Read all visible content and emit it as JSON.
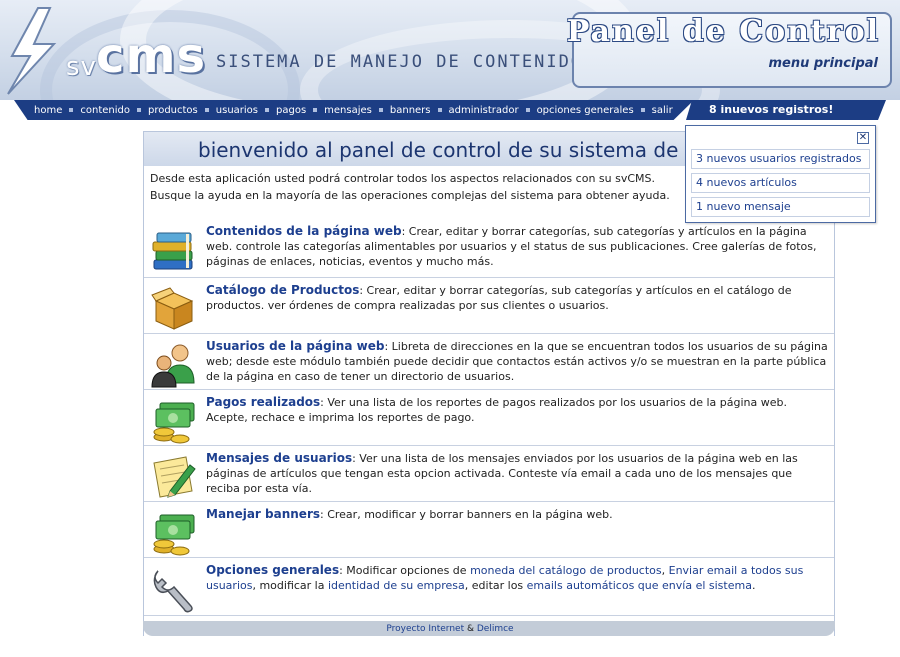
{
  "header": {
    "brand_prefix": "sv",
    "brand_name": "cms",
    "brand_subtitle": "SISTEMA DE MANEJO DE CONTENIDO WEB",
    "title": "Panel de Control",
    "subtitle": "menu principal"
  },
  "nav": {
    "items": [
      "home",
      "contenido",
      "productos",
      "usuarios",
      "pagos",
      "mensajes",
      "banners",
      "administrador",
      "opciones generales",
      "salir"
    ],
    "new_records": "8 inuevos registros!"
  },
  "panel": {
    "title": "bienvenido al panel de control de su sistema de contenido",
    "intro": "Desde esta aplicación usted podrá controlar todos los aspectos relacionados con su svCMS. Busque la ayuda en la mayoría de las operaciones complejas del sistema para obtener ayuda."
  },
  "sections": [
    {
      "icon": "books-icon",
      "title": "Contenidos de la página web",
      "text": ": Crear, editar y borrar categorías, sub categorías  y artículos en la página web. controle las categorías alimentables por usuarios y el status de sus publicaciones. Cree galerías de fotos, páginas de enlaces, noticias, eventos y mucho más."
    },
    {
      "icon": "box-icon",
      "title": "Catálogo de Productos",
      "text": ": Crear, editar y borrar categorías, sub categorías y artículos en el catálogo de productos. ver órdenes de compra realizadas por sus clientes o usuarios."
    },
    {
      "icon": "users-icon",
      "title": "Usuarios de la página web",
      "text": ": Libreta de direcciones en la que se encuentran todos los usuarios de su página web; desde este módulo también puede decidir que contactos están activos y/o se muestran en la parte pública de la página en caso de tener un directorio de usuarios."
    },
    {
      "icon": "money-icon",
      "title": "Pagos realizados",
      "text": ": Ver una lista de los reportes de pagos realizados por los usuarios de la página web. Acepte, rechace e imprima los reportes de pago."
    },
    {
      "icon": "note-pencil-icon",
      "title": "Mensajes de usuarios",
      "text": ": Ver una lista de los mensajes enviados por los usuarios de la página web en las páginas de artículos que tengan esta opcion activada. Conteste vía email a cada uno de los mensajes que reciba por esta vía."
    },
    {
      "icon": "money-icon",
      "title": "Manejar banners",
      "text": ": Crear, modificar y borrar banners en la página web."
    },
    {
      "icon": "wrench-icon",
      "title": "Opciones generales",
      "text_parts": [
        ": Modificar opciones de ",
        "moneda del catálogo de productos",
        ", ",
        "Enviar email a todos sus usuarios",
        ", modificar la ",
        "identidad de su empresa",
        ", editar los ",
        "emails automáticos que envía el sistema",
        "."
      ]
    }
  ],
  "popup": {
    "close": "✕",
    "items": [
      "3 nuevos usuarios registrados",
      "4 nuevos artículos",
      "1 nuevo mensaje"
    ]
  },
  "footer": {
    "link1": "Proyecto Internet",
    "separator": " & ",
    "link2": "Delimce"
  },
  "colors": {
    "nav_bg": "#1c3d84",
    "link": "#1d3f8f",
    "title": "#1c3570"
  }
}
